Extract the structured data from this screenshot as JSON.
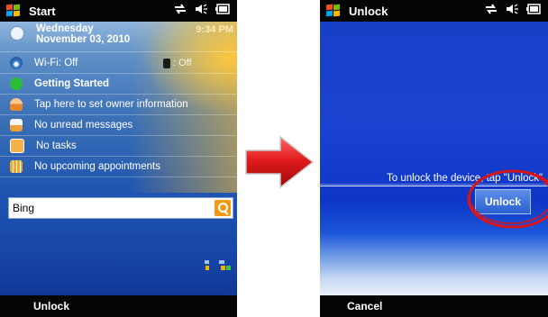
{
  "left_screen": {
    "title": "Start",
    "date_line1": "Wednesday",
    "date_line2": "November 03, 2010",
    "clock": "9:34 PM",
    "wifi_label": "Wi-Fi: Off",
    "bluetooth_label": ": Off",
    "items": [
      {
        "label": "Getting Started",
        "icon": "getting-started-icon"
      },
      {
        "label": "Tap here to set owner information",
        "icon": "owner-icon"
      },
      {
        "label": "No unread messages",
        "icon": "messages-icon"
      },
      {
        "label": "No tasks",
        "icon": "tasks-icon"
      },
      {
        "label": "No upcoming appointments",
        "icon": "calendar-icon"
      }
    ],
    "search_value": "Bing",
    "softkey": "Unlock"
  },
  "right_screen": {
    "title": "Unlock",
    "instruction": "To unlock the device, tap \"Unlock\".",
    "unlock_button": "Unlock",
    "softkey": "Cancel"
  },
  "colors": {
    "accent_red": "#d8141c",
    "start_blue": "#1f55b0",
    "unlock_blue": "#1740c8"
  }
}
